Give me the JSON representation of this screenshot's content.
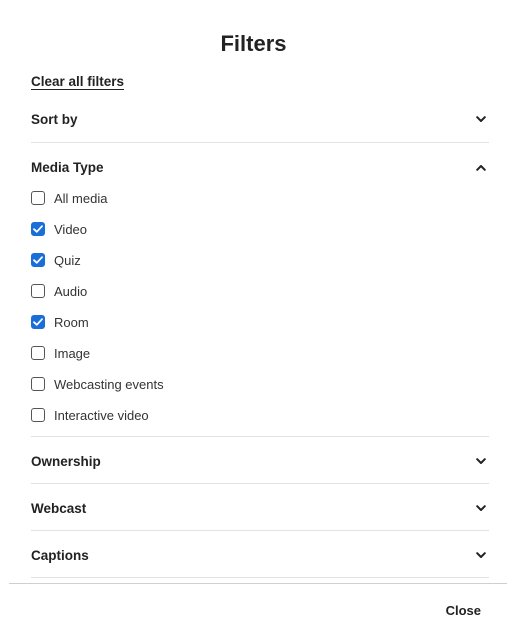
{
  "dialog": {
    "title": "Filters",
    "clear_all_label": "Clear all filters",
    "close_label": "Close"
  },
  "sections": {
    "sort_by": {
      "label": "Sort by",
      "expanded": false
    },
    "media_type": {
      "label": "Media Type",
      "expanded": true,
      "options": [
        {
          "label": "All media",
          "checked": false
        },
        {
          "label": "Video",
          "checked": true
        },
        {
          "label": "Quiz",
          "checked": true
        },
        {
          "label": "Audio",
          "checked": false
        },
        {
          "label": "Room",
          "checked": true
        },
        {
          "label": "Image",
          "checked": false
        },
        {
          "label": "Webcasting events",
          "checked": false
        },
        {
          "label": "Interactive video",
          "checked": false
        }
      ]
    },
    "ownership": {
      "label": "Ownership",
      "expanded": false
    },
    "webcast": {
      "label": "Webcast",
      "expanded": false
    },
    "captions": {
      "label": "Captions",
      "expanded": false
    }
  },
  "icons": {
    "collapsed": "chevron-down-icon",
    "expanded": "chevron-up-icon",
    "checked": "checkmark-icon"
  },
  "colors": {
    "accent": "#1a6ed8",
    "text": "#222222",
    "divider": "#e3e3e3"
  }
}
